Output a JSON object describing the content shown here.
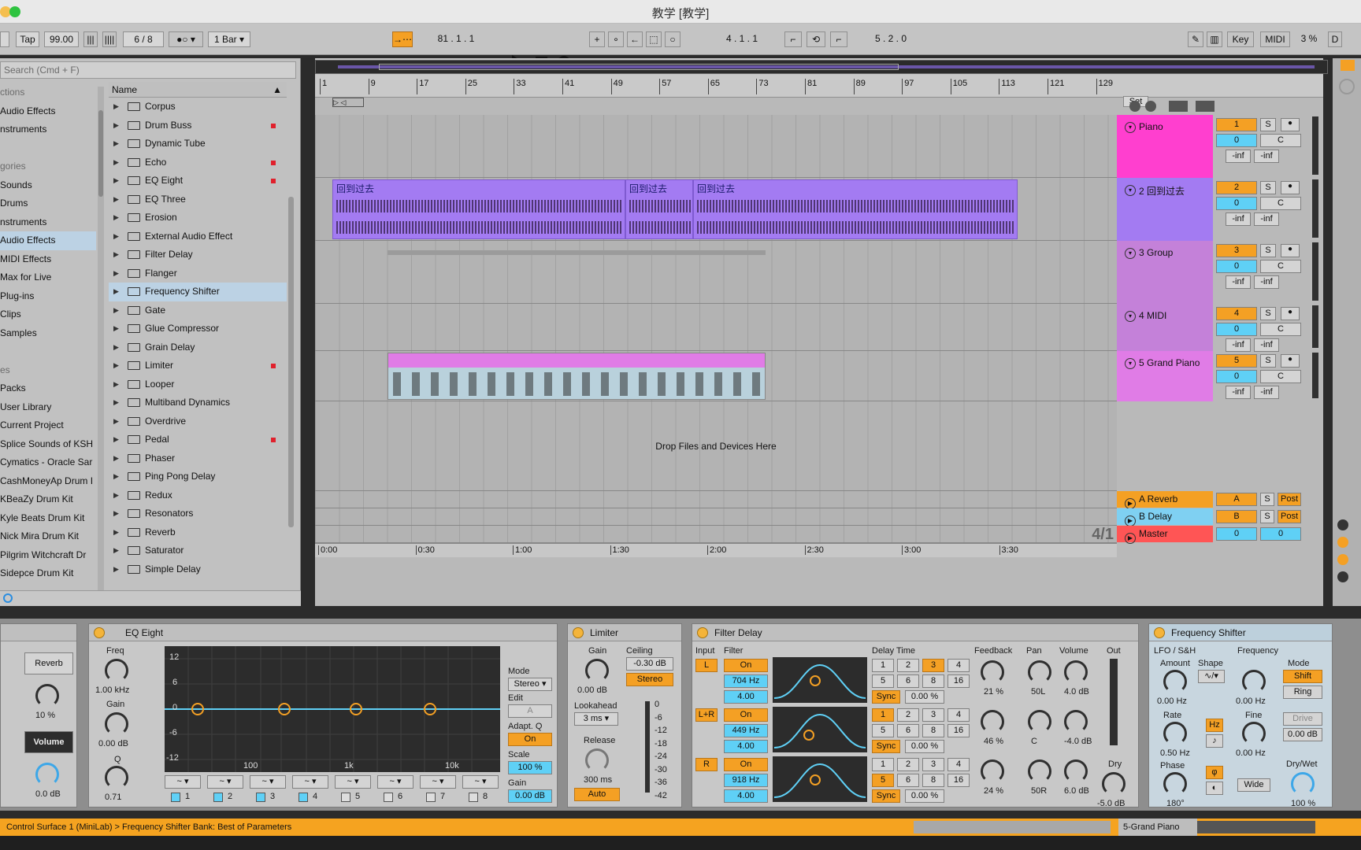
{
  "window": {
    "title": "教学 [教学]"
  },
  "transport": {
    "tap": "Tap",
    "tempo": "99.00",
    "signature": "6 / 8",
    "bar": "1 Bar",
    "position": "81 .  1 .  1",
    "loop_start": "4 .  1 .  1",
    "loop_length": "5 .  2 .  0",
    "key": "Key",
    "midi": "MIDI",
    "cpu": "3 %",
    "d": "D"
  },
  "browser": {
    "search_placeholder": "Search (Cmd + F)",
    "places": [
      "ctions",
      "Audio Effects",
      "nstruments",
      "",
      "gories",
      "Sounds",
      "Drums",
      "nstruments",
      "Audio Effects",
      "MIDI Effects",
      "Max for Live",
      "Plug-ins",
      "Clips",
      "Samples",
      "",
      "es",
      "Packs",
      "User Library",
      "Current Project",
      "Splice Sounds of KSH",
      "Cymatics - Oracle Sar",
      "CashMoneyAp Drum I",
      "KBeaZy Drum Kit",
      "Kyle Beats Drum Kit",
      "Nick Mira Drum Kit",
      "Pilgrim Witchcraft Dr",
      "Sidepce Drum Kit"
    ],
    "column_header": "Name",
    "items": [
      "Corpus",
      "Drum Buss",
      "Dynamic Tube",
      "Echo",
      "EQ Eight",
      "EQ Three",
      "Erosion",
      "External Audio Effect",
      "Filter Delay",
      "Flanger",
      "Frequency Shifter",
      "Gate",
      "Glue Compressor",
      "Grain Delay",
      "Limiter",
      "Looper",
      "Multiband Dynamics",
      "Overdrive",
      "Pedal",
      "Phaser",
      "Ping Pong Delay",
      "Redux",
      "Resonators",
      "Reverb",
      "Saturator",
      "Simple Delay"
    ]
  },
  "ruler": [
    "1",
    "9",
    "17",
    "25",
    "33",
    "41",
    "49",
    "57",
    "65",
    "73",
    "81",
    "89",
    "97",
    "105",
    "113",
    "121",
    "129"
  ],
  "timeline": [
    "0:00",
    "0:30",
    "1:00",
    "1:30",
    "2:00",
    "2:30",
    "3:00",
    "3:30"
  ],
  "set_label": "Set",
  "clips": {
    "audio_name": "回到过去"
  },
  "drop_text": "Drop Files and Devices Here",
  "grid_label": "4/1",
  "tracks": [
    {
      "name": "Piano",
      "num": "1",
      "color": "#ff3fcf"
    },
    {
      "name": "2 回到过去",
      "num": "2",
      "color": "#a37bf2"
    },
    {
      "name": "3 Group",
      "num": "3",
      "color": "#c481d9"
    },
    {
      "name": "4 MIDI",
      "num": "4",
      "color": "#c481d9"
    },
    {
      "name": "5 Grand Piano",
      "num": "5",
      "color": "#e07ce6"
    }
  ],
  "returns": [
    {
      "name": "A Reverb",
      "letter": "A"
    },
    {
      "name": "B Delay",
      "letter": "B"
    },
    {
      "name": "Master",
      "vol": "0"
    }
  ],
  "mixer": {
    "vol": "0",
    "pan": "C",
    "inf": "-inf",
    "solo": "S",
    "post": "Post"
  },
  "devices": {
    "partial": {
      "reverb": "Reverb",
      "pct": "10 %",
      "volume": "Volume",
      "db": "0.0 dB"
    },
    "eq": {
      "title": "EQ Eight",
      "freq_label": "Freq",
      "freq": "1.00 kHz",
      "gain_label": "Gain",
      "gain": "0.00 dB",
      "q_label": "Q",
      "q": "0.71",
      "y_ticks": [
        "12",
        "6",
        "0",
        "-6",
        "-12"
      ],
      "x_ticks": [
        "100",
        "1k",
        "10k"
      ],
      "mode_label": "Mode",
      "mode": "Stereo",
      "edit_label": "Edit",
      "edit": "A",
      "adapt_label": "Adapt. Q",
      "adapt": "On",
      "scale_label": "Scale",
      "scale": "100 %",
      "out_gain_label": "Gain",
      "out_gain": "0.00 dB",
      "bands": [
        "1",
        "2",
        "3",
        "4",
        "5",
        "6",
        "7",
        "8"
      ]
    },
    "limiter": {
      "title": "Limiter",
      "gain_label": "Gain",
      "gain": "0.00 dB",
      "ceiling_label": "Ceiling",
      "ceiling": "-0.30 dB",
      "stereo": "Stereo",
      "lookahead_label": "Lookahead",
      "lookahead": "3 ms",
      "release_label": "Release",
      "release": "300 ms",
      "auto": "Auto",
      "meter": [
        "0",
        "-6",
        "-12",
        "-18",
        "-24",
        "-30",
        "-36",
        "-42"
      ]
    },
    "filterdelay": {
      "title": "Filter Delay",
      "input": "Input",
      "filter": "Filter",
      "delay_time": "Delay Time",
      "feedback": "Feedback",
      "pan": "Pan",
      "volume": "Volume",
      "out": "Out",
      "dry": "Dry",
      "sync": "Sync",
      "on": "On",
      "rows": [
        {
          "input": "L",
          "freq": "704 Hz",
          "q": "4.00",
          "pct": "0.00 %",
          "fb": "21 %",
          "pan": "50L",
          "vol": "4.0 dB"
        },
        {
          "input": "L+R",
          "freq": "449 Hz",
          "q": "4.00",
          "pct": "0.00 %",
          "fb": "46 %",
          "pan": "C",
          "vol": "-4.0 dB"
        },
        {
          "input": "R",
          "freq": "918 Hz",
          "q": "4.00",
          "pct": "0.00 %",
          "fb": "24 %",
          "pan": "50R",
          "vol": "6.0 dB"
        }
      ],
      "grid": [
        "1",
        "2",
        "3",
        "4",
        "5",
        "6",
        "8",
        "16"
      ],
      "dry_val": "-5.0 dB"
    },
    "freqshifter": {
      "title": "Frequency Shifter",
      "lfo": "LFO / S&H",
      "amount_label": "Amount",
      "amount": "0.00 Hz",
      "shape_label": "Shape",
      "rate_label": "Rate",
      "rate": "0.50 Hz",
      "hz": "Hz",
      "phase_label": "Phase",
      "phase": "180°",
      "frequency_label": "Frequency",
      "frequency": "0.00 Hz",
      "fine_label": "Fine",
      "fine": "0.00 Hz",
      "mode_label": "Mode",
      "shift": "Shift",
      "ring": "Ring",
      "drive": "Drive",
      "drive_val": "0.00 dB",
      "wide": "Wide",
      "drywet_label": "Dry/Wet",
      "drywet": "100 %"
    }
  },
  "status": {
    "text": "Control Surface 1 (MiniLab) > Frequency Shifter Bank: Best of Parameters",
    "track": "5-Grand Piano"
  }
}
